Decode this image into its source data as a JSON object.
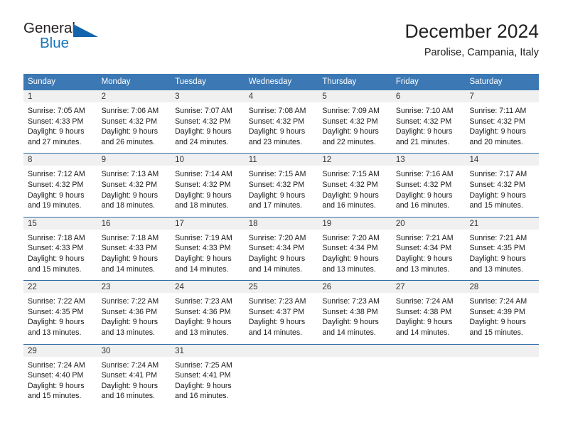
{
  "logo": {
    "primary_text": "General",
    "secondary_text": "Blue",
    "primary_color": "#231f20",
    "secondary_color": "#1574bb",
    "triangle_color": "#1265ad",
    "icon": "triangle-icon"
  },
  "header": {
    "title": "December 2024",
    "subtitle": "Parolise, Campania, Italy"
  },
  "theme": {
    "header_bg": "#3c78b4",
    "header_text": "#ffffff",
    "week_separator": "#2d6ca8",
    "day_band_bg": "#f0f0f0"
  },
  "weekdays": [
    "Sunday",
    "Monday",
    "Tuesday",
    "Wednesday",
    "Thursday",
    "Friday",
    "Saturday"
  ],
  "weeks": [
    [
      {
        "day": "1",
        "sunrise": "Sunrise: 7:05 AM",
        "sunset": "Sunset: 4:33 PM",
        "daylight": "Daylight: 9 hours and 27 minutes."
      },
      {
        "day": "2",
        "sunrise": "Sunrise: 7:06 AM",
        "sunset": "Sunset: 4:32 PM",
        "daylight": "Daylight: 9 hours and 26 minutes."
      },
      {
        "day": "3",
        "sunrise": "Sunrise: 7:07 AM",
        "sunset": "Sunset: 4:32 PM",
        "daylight": "Daylight: 9 hours and 24 minutes."
      },
      {
        "day": "4",
        "sunrise": "Sunrise: 7:08 AM",
        "sunset": "Sunset: 4:32 PM",
        "daylight": "Daylight: 9 hours and 23 minutes."
      },
      {
        "day": "5",
        "sunrise": "Sunrise: 7:09 AM",
        "sunset": "Sunset: 4:32 PM",
        "daylight": "Daylight: 9 hours and 22 minutes."
      },
      {
        "day": "6",
        "sunrise": "Sunrise: 7:10 AM",
        "sunset": "Sunset: 4:32 PM",
        "daylight": "Daylight: 9 hours and 21 minutes."
      },
      {
        "day": "7",
        "sunrise": "Sunrise: 7:11 AM",
        "sunset": "Sunset: 4:32 PM",
        "daylight": "Daylight: 9 hours and 20 minutes."
      }
    ],
    [
      {
        "day": "8",
        "sunrise": "Sunrise: 7:12 AM",
        "sunset": "Sunset: 4:32 PM",
        "daylight": "Daylight: 9 hours and 19 minutes."
      },
      {
        "day": "9",
        "sunrise": "Sunrise: 7:13 AM",
        "sunset": "Sunset: 4:32 PM",
        "daylight": "Daylight: 9 hours and 18 minutes."
      },
      {
        "day": "10",
        "sunrise": "Sunrise: 7:14 AM",
        "sunset": "Sunset: 4:32 PM",
        "daylight": "Daylight: 9 hours and 18 minutes."
      },
      {
        "day": "11",
        "sunrise": "Sunrise: 7:15 AM",
        "sunset": "Sunset: 4:32 PM",
        "daylight": "Daylight: 9 hours and 17 minutes."
      },
      {
        "day": "12",
        "sunrise": "Sunrise: 7:15 AM",
        "sunset": "Sunset: 4:32 PM",
        "daylight": "Daylight: 9 hours and 16 minutes."
      },
      {
        "day": "13",
        "sunrise": "Sunrise: 7:16 AM",
        "sunset": "Sunset: 4:32 PM",
        "daylight": "Daylight: 9 hours and 16 minutes."
      },
      {
        "day": "14",
        "sunrise": "Sunrise: 7:17 AM",
        "sunset": "Sunset: 4:32 PM",
        "daylight": "Daylight: 9 hours and 15 minutes."
      }
    ],
    [
      {
        "day": "15",
        "sunrise": "Sunrise: 7:18 AM",
        "sunset": "Sunset: 4:33 PM",
        "daylight": "Daylight: 9 hours and 15 minutes."
      },
      {
        "day": "16",
        "sunrise": "Sunrise: 7:18 AM",
        "sunset": "Sunset: 4:33 PM",
        "daylight": "Daylight: 9 hours and 14 minutes."
      },
      {
        "day": "17",
        "sunrise": "Sunrise: 7:19 AM",
        "sunset": "Sunset: 4:33 PM",
        "daylight": "Daylight: 9 hours and 14 minutes."
      },
      {
        "day": "18",
        "sunrise": "Sunrise: 7:20 AM",
        "sunset": "Sunset: 4:34 PM",
        "daylight": "Daylight: 9 hours and 14 minutes."
      },
      {
        "day": "19",
        "sunrise": "Sunrise: 7:20 AM",
        "sunset": "Sunset: 4:34 PM",
        "daylight": "Daylight: 9 hours and 13 minutes."
      },
      {
        "day": "20",
        "sunrise": "Sunrise: 7:21 AM",
        "sunset": "Sunset: 4:34 PM",
        "daylight": "Daylight: 9 hours and 13 minutes."
      },
      {
        "day": "21",
        "sunrise": "Sunrise: 7:21 AM",
        "sunset": "Sunset: 4:35 PM",
        "daylight": "Daylight: 9 hours and 13 minutes."
      }
    ],
    [
      {
        "day": "22",
        "sunrise": "Sunrise: 7:22 AM",
        "sunset": "Sunset: 4:35 PM",
        "daylight": "Daylight: 9 hours and 13 minutes."
      },
      {
        "day": "23",
        "sunrise": "Sunrise: 7:22 AM",
        "sunset": "Sunset: 4:36 PM",
        "daylight": "Daylight: 9 hours and 13 minutes."
      },
      {
        "day": "24",
        "sunrise": "Sunrise: 7:23 AM",
        "sunset": "Sunset: 4:36 PM",
        "daylight": "Daylight: 9 hours and 13 minutes."
      },
      {
        "day": "25",
        "sunrise": "Sunrise: 7:23 AM",
        "sunset": "Sunset: 4:37 PM",
        "daylight": "Daylight: 9 hours and 14 minutes."
      },
      {
        "day": "26",
        "sunrise": "Sunrise: 7:23 AM",
        "sunset": "Sunset: 4:38 PM",
        "daylight": "Daylight: 9 hours and 14 minutes."
      },
      {
        "day": "27",
        "sunrise": "Sunrise: 7:24 AM",
        "sunset": "Sunset: 4:38 PM",
        "daylight": "Daylight: 9 hours and 14 minutes."
      },
      {
        "day": "28",
        "sunrise": "Sunrise: 7:24 AM",
        "sunset": "Sunset: 4:39 PM",
        "daylight": "Daylight: 9 hours and 15 minutes."
      }
    ],
    [
      {
        "day": "29",
        "sunrise": "Sunrise: 7:24 AM",
        "sunset": "Sunset: 4:40 PM",
        "daylight": "Daylight: 9 hours and 15 minutes."
      },
      {
        "day": "30",
        "sunrise": "Sunrise: 7:24 AM",
        "sunset": "Sunset: 4:41 PM",
        "daylight": "Daylight: 9 hours and 16 minutes."
      },
      {
        "day": "31",
        "sunrise": "Sunrise: 7:25 AM",
        "sunset": "Sunset: 4:41 PM",
        "daylight": "Daylight: 9 hours and 16 minutes."
      },
      {
        "day": "",
        "sunrise": "",
        "sunset": "",
        "daylight": ""
      },
      {
        "day": "",
        "sunrise": "",
        "sunset": "",
        "daylight": ""
      },
      {
        "day": "",
        "sunrise": "",
        "sunset": "",
        "daylight": ""
      },
      {
        "day": "",
        "sunrise": "",
        "sunset": "",
        "daylight": ""
      }
    ]
  ]
}
